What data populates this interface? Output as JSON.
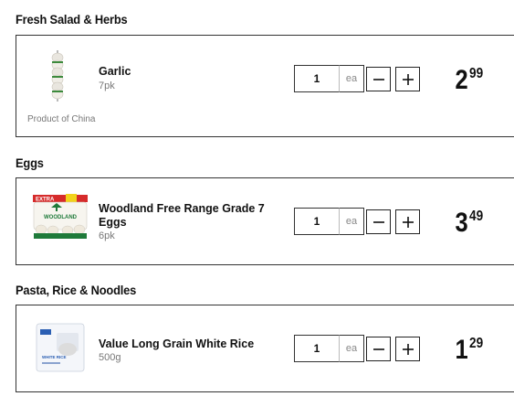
{
  "sections": [
    {
      "title": "Fresh Salad & Herbs",
      "product": {
        "name": "Garlic",
        "size": "7pk",
        "origin": "Product of China",
        "quantity": "1",
        "unit": "ea",
        "price_dollars": "2",
        "price_cents": "99",
        "image_icon": "garlic-image"
      }
    },
    {
      "title": "Eggs",
      "product": {
        "name_line1": "Woodland Free Range Grade 7",
        "name_line2": "Eggs",
        "size": "6pk",
        "quantity": "1",
        "unit": "ea",
        "price_dollars": "3",
        "price_cents": "49",
        "image_icon": "egg-carton-image",
        "image_text": {
          "banner": "EXTRA",
          "brand": "WOODLAND"
        }
      }
    },
    {
      "title": "Pasta, Rice & Noodles",
      "product": {
        "name": "Value Long Grain White Rice",
        "size": "500g",
        "quantity": "1",
        "unit": "ea",
        "price_dollars": "1",
        "price_cents": "29",
        "image_icon": "rice-bag-image",
        "image_text": {
          "label": "WHITE RICE"
        }
      }
    }
  ],
  "controls": {
    "minus_icon": "minus-icon",
    "plus_icon": "plus-icon"
  },
  "colors": {
    "border": "#333333",
    "text": "#111111",
    "muted": "#777777",
    "egg_banner_red": "#d62b2b",
    "egg_banner_yellow": "#f2d21b",
    "egg_carton_green": "#1f7a3a"
  }
}
